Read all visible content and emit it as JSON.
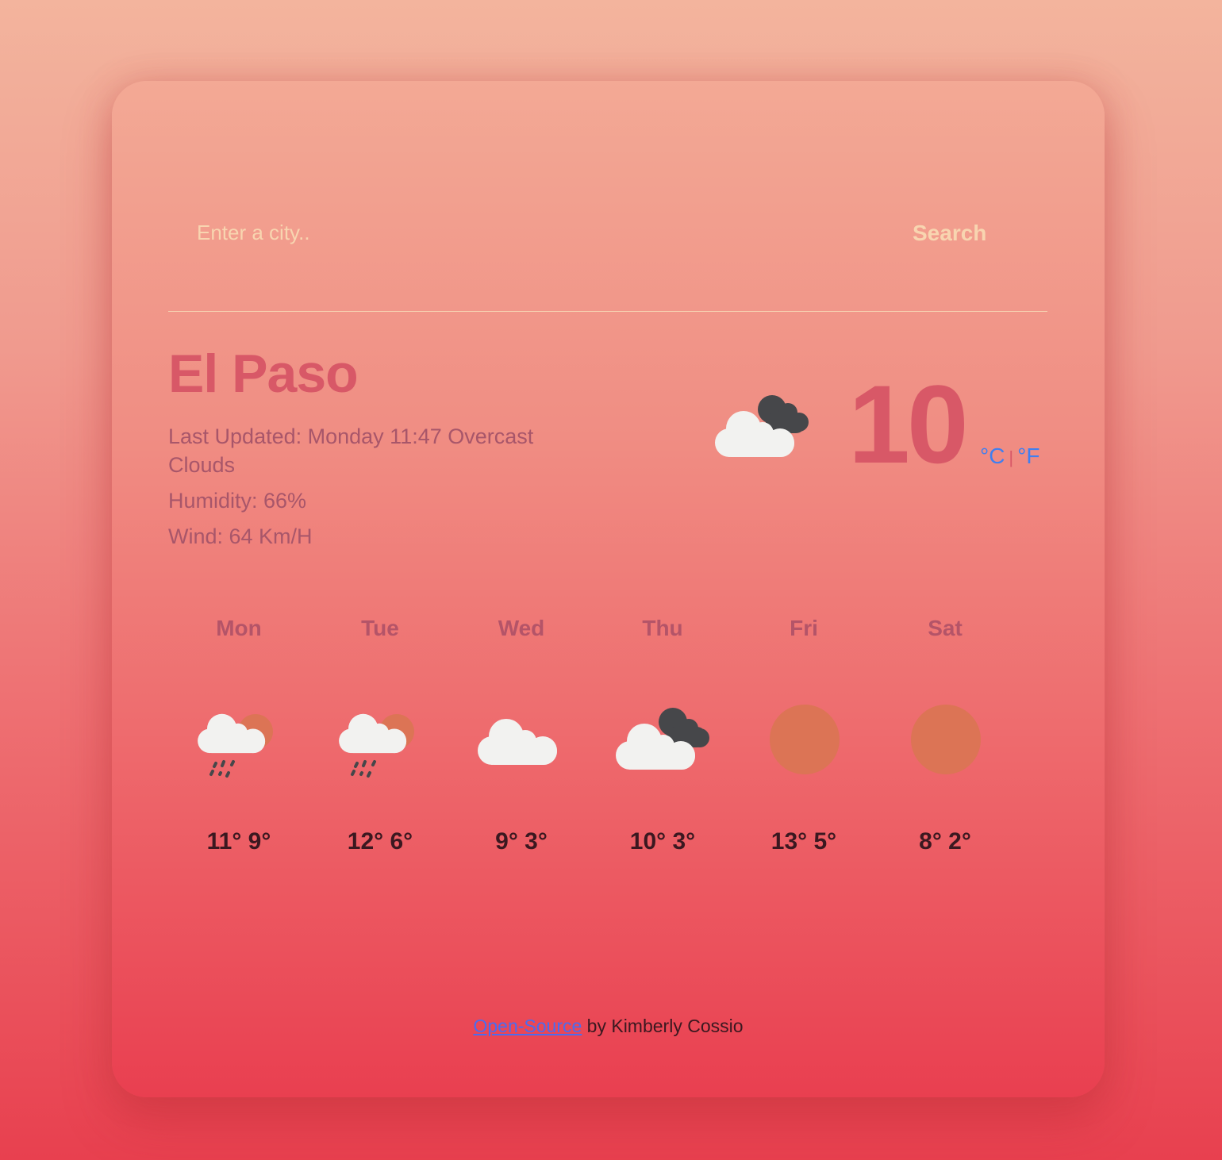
{
  "search": {
    "placeholder": "Enter a city..",
    "value": "",
    "button_label": "Search"
  },
  "current": {
    "city": "El Paso",
    "last_updated": "Last Updated: Monday 11:47 Overcast Clouds",
    "humidity": "Humidity: 66%",
    "wind": "Wind: 64 Km/H",
    "temperature": "10",
    "icon": "broken-clouds-icon",
    "unit_celsius": "°C",
    "unit_separator": "|",
    "unit_fahrenheit": "°F"
  },
  "forecast": [
    {
      "day": "Mon",
      "temps": "11° 9°",
      "icon": "rain-sun-icon"
    },
    {
      "day": "Tue",
      "temps": "12° 6°",
      "icon": "rain-sun-icon"
    },
    {
      "day": "Wed",
      "temps": "9° 3°",
      "icon": "cloud-icon"
    },
    {
      "day": "Thu",
      "temps": "10° 3°",
      "icon": "broken-clouds-icon"
    },
    {
      "day": "Fri",
      "temps": "13° 5°",
      "icon": "sun-icon"
    },
    {
      "day": "Sat",
      "temps": "8° 2°",
      "icon": "sun-icon"
    }
  ],
  "footer": {
    "link_text": "Open-Source",
    "text": " by Kimberly Cossio"
  },
  "colors": {
    "accent": "#d85867",
    "link": "#3f7ff0",
    "cream": "#f8d5b0",
    "sun": "#dc7455",
    "cloud": "#f2f2f0",
    "dark_cloud": "#46474a"
  }
}
